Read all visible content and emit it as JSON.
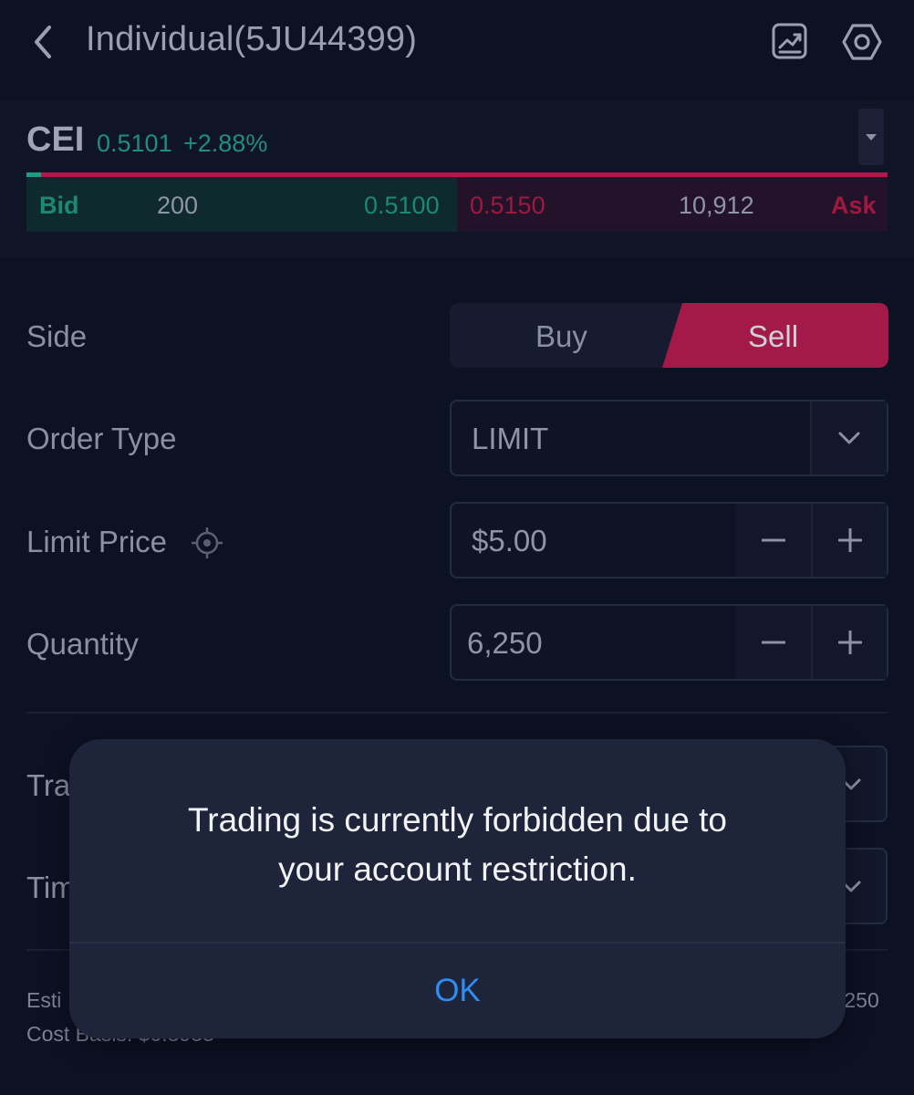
{
  "header": {
    "account_title": "Individual(5JU44399)",
    "icons": [
      "back-icon",
      "chart-icon",
      "gear-icon"
    ]
  },
  "quote": {
    "symbol": "CEI",
    "last_price": "0.5101",
    "change_pct": "+2.88%",
    "bid_label": "Bid",
    "bid_size": "200",
    "bid_price": "0.5100",
    "ask_price": "0.5150",
    "ask_size": "10,912",
    "ask_label": "Ask"
  },
  "form": {
    "side_label": "Side",
    "buy_label": "Buy",
    "sell_label": "Sell",
    "selected_side": "Sell",
    "order_type_label": "Order Type",
    "order_type_value": "LIMIT",
    "limit_price_label": "Limit Price",
    "limit_price_value": "$5.00",
    "quantity_label": "Quantity",
    "quantity_value": "6,250",
    "trading_session_label_visible": "Tra",
    "time_in_force_label_visible": "Tim",
    "estimate_label_visible": "Esti",
    "cost_basis_visible": "Cost Basis: $0.8933",
    "estimate_value_visible": ",250"
  },
  "modal": {
    "message_line1": "Trading is currently forbidden due to",
    "message_line2": "your account restriction.",
    "ok_label": "OK"
  },
  "colors": {
    "background": "#0d1124",
    "bid_green": "#1a8a72",
    "ask_red": "#a1183f",
    "sell_active": "#a31947",
    "modal_bg": "#1e2439",
    "ok_blue": "#2f8cf0"
  }
}
